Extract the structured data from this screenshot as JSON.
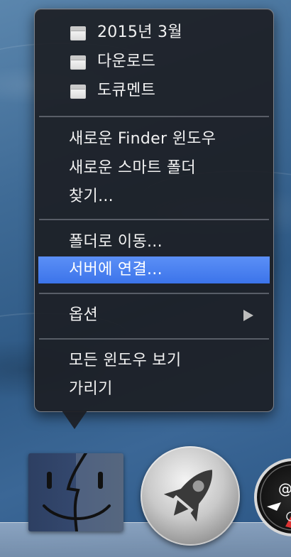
{
  "context_menu": {
    "recent_items": [
      {
        "label": "2015년 3월",
        "icon": "folder-window-icon"
      },
      {
        "label": "다운로드",
        "icon": "folder-window-icon"
      },
      {
        "label": "도큐멘트",
        "icon": "folder-window-icon"
      }
    ],
    "new_finder_window": "새로운 Finder 윈도우",
    "new_smart_folder": "새로운 스마트 폴더",
    "find": "찾기...",
    "go_to_folder": "폴더로 이동...",
    "connect_to_server": "서버에 연결...",
    "options": "옵션",
    "show_all_windows": "모든 윈도우 보기",
    "hide": "가리기",
    "selected_item": "서버에 연결...",
    "highlight_color": "#4a80f0"
  },
  "dock": {
    "items": [
      {
        "name": "Finder",
        "icon": "finder-icon"
      },
      {
        "name": "Launchpad",
        "icon": "rocket-icon"
      },
      {
        "name": "Safari",
        "icon": "compass-icon"
      }
    ]
  }
}
